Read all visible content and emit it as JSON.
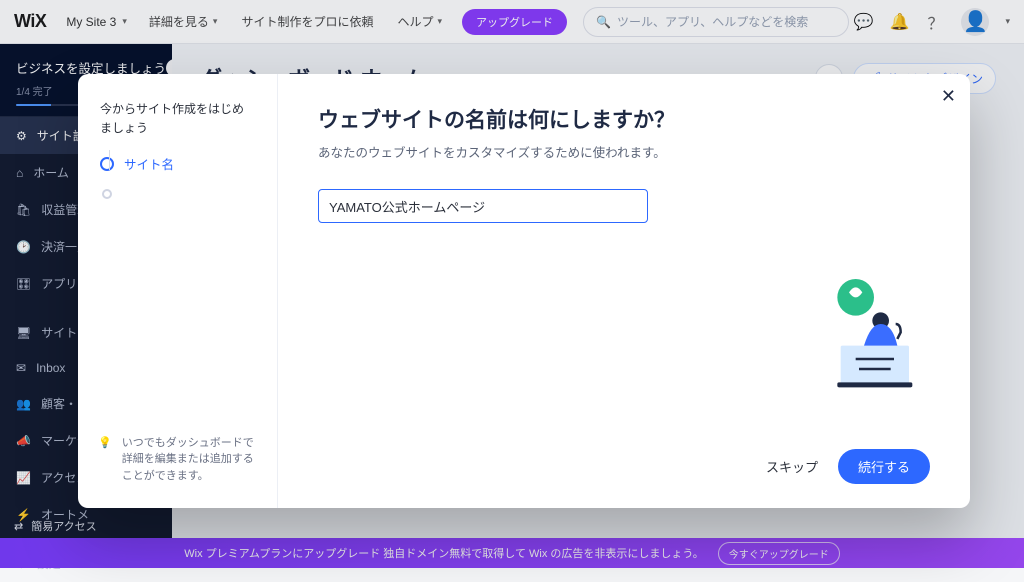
{
  "topbar": {
    "logo": "WiX",
    "site_name": "My Site 3",
    "links": {
      "details": "詳細を見る",
      "pro": "サイト制作をプロに依頼",
      "help": "ヘルプ"
    },
    "upgrade": "アップグレード",
    "search_placeholder": "ツール、アプリ、ヘルプなどを検索"
  },
  "sidebar": {
    "setup_title": "ビジネスを設定しましょう",
    "progress_text": "1/4 完了",
    "items": [
      "サイト設定",
      "ホーム",
      "収益管理",
      "決済一覧",
      "アプリ",
      "サイト・",
      "Inbox",
      "顧客・リ",
      "マーケテ",
      "アクセス",
      "オートメ",
      "設定"
    ]
  },
  "main": {
    "title": "ダッシュボード ホーム",
    "design_button": "サイトをデザイン"
  },
  "quick_access": "簡易アクセス",
  "banner": {
    "text": "Wix プレミアムプランにアップグレード 独自ドメイン無料で取得して Wix の広告を非表示にしましょう。",
    "cta": "今すぐアップグレード"
  },
  "modal": {
    "left_title": "今からサイト作成をはじめましょう",
    "step1": "サイト名",
    "hint": "いつでもダッシュボードで詳細を編集または追加することができます。",
    "title": "ウェブサイトの名前は何にしますか？",
    "subtitle": "あなたのウェブサイトをカスタマイズするために使われます。",
    "input_value": "YAMATO公式ホームページ",
    "skip": "スキップ",
    "continue": "続行する"
  }
}
